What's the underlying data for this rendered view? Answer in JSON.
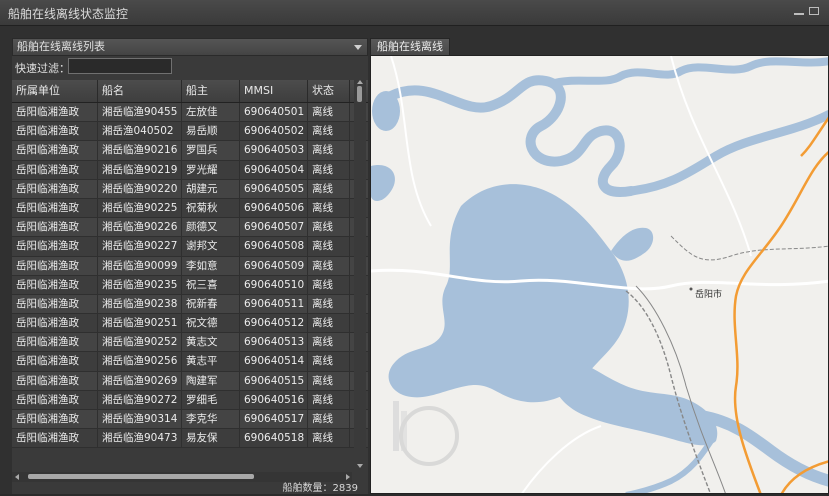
{
  "window": {
    "title": "船舶在线离线状态监控"
  },
  "list_panel": {
    "header": "船舶在线离线列表",
    "filter_label": "快速过滤：",
    "filter_value": "",
    "columns": [
      "所属单位",
      "船名",
      "船主",
      "MMSI",
      "状态"
    ],
    "rows": [
      [
        "岳阳临湘渔政",
        "湘岳临渔90455",
        "左放佳",
        "690640501",
        "离线"
      ],
      [
        "岳阳临湘渔政",
        "湘岳渔040502",
        "易岳顺",
        "690640502",
        "离线"
      ],
      [
        "岳阳临湘渔政",
        "湘岳临渔90216",
        "罗国兵",
        "690640503",
        "离线"
      ],
      [
        "岳阳临湘渔政",
        "湘岳临渔90219",
        "罗光耀",
        "690640504",
        "离线"
      ],
      [
        "岳阳临湘渔政",
        "湘岳临渔90220",
        "胡建元",
        "690640505",
        "离线"
      ],
      [
        "岳阳临湘渔政",
        "湘岳临渔90225",
        "祝菊秋",
        "690640506",
        "离线"
      ],
      [
        "岳阳临湘渔政",
        "湘岳临渔90226",
        "颜德又",
        "690640507",
        "离线"
      ],
      [
        "岳阳临湘渔政",
        "湘岳临渔90227",
        "谢邦文",
        "690640508",
        "离线"
      ],
      [
        "岳阳临湘渔政",
        "湘岳临渔90099",
        "李如意",
        "690640509",
        "离线"
      ],
      [
        "岳阳临湘渔政",
        "湘岳临渔90235",
        "祝三喜",
        "690640510",
        "离线"
      ],
      [
        "岳阳临湘渔政",
        "湘岳临渔90238",
        "祝新春",
        "690640511",
        "离线"
      ],
      [
        "岳阳临湘渔政",
        "湘岳临渔90251",
        "祝文德",
        "690640512",
        "离线"
      ],
      [
        "岳阳临湘渔政",
        "湘岳临渔90252",
        "黄志文",
        "690640513",
        "离线"
      ],
      [
        "岳阳临湘渔政",
        "湘岳临渔90256",
        "黄志平",
        "690640514",
        "离线"
      ],
      [
        "岳阳临湘渔政",
        "湘岳临渔90269",
        "陶建军",
        "690640515",
        "离线"
      ],
      [
        "岳阳临湘渔政",
        "湘岳临渔90272",
        "罗细毛",
        "690640516",
        "离线"
      ],
      [
        "岳阳临湘渔政",
        "湘岳临渔90314",
        "李克华",
        "690640517",
        "离线"
      ],
      [
        "岳阳临湘渔政",
        "湘岳临渔90473",
        "易友保",
        "690640518",
        "离线"
      ]
    ],
    "footer": "船舶数量：2839"
  },
  "map_panel": {
    "tab": "船舶在线离线",
    "city_label": "岳阳市",
    "colors": {
      "water": "#a7c0da",
      "land": "#f1f0ed",
      "road_orange": "#f39c34",
      "road_white": "#ffffff",
      "rail": "#888888"
    }
  }
}
